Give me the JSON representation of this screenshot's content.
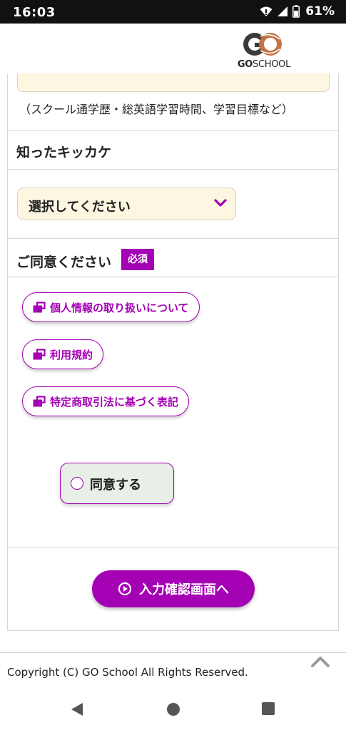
{
  "status_bar": {
    "time": "16:03",
    "battery": "61%",
    "icons": [
      "wifi-icon",
      "signal-icon",
      "battery-icon"
    ]
  },
  "header": {
    "logo_text_bold": "GO",
    "logo_text_thin": "SCHOOL"
  },
  "form": {
    "hint": "（スクール通学歴・総英語学習時間、学習目標など）",
    "source_label": "知ったキッカケ",
    "source_select_value": "選択してください",
    "consent_label": "ご同意ください",
    "required_badge": "必須",
    "links": [
      {
        "label": "個人情報の取り扱いについて",
        "icon": "external-link-icon"
      },
      {
        "label": "利用規約",
        "icon": "external-link-icon"
      },
      {
        "label": "特定商取引法に基づく表記",
        "icon": "external-link-icon"
      }
    ],
    "agree_label": "同意する",
    "submit_label": "入力確認画面へ"
  },
  "footer": {
    "copyright": "Copyright (C) GO School All Rights Reserved."
  },
  "colors": {
    "accent": "#a400b4",
    "field_bg": "#fdf7e2",
    "agree_bg": "#e7efe6"
  }
}
